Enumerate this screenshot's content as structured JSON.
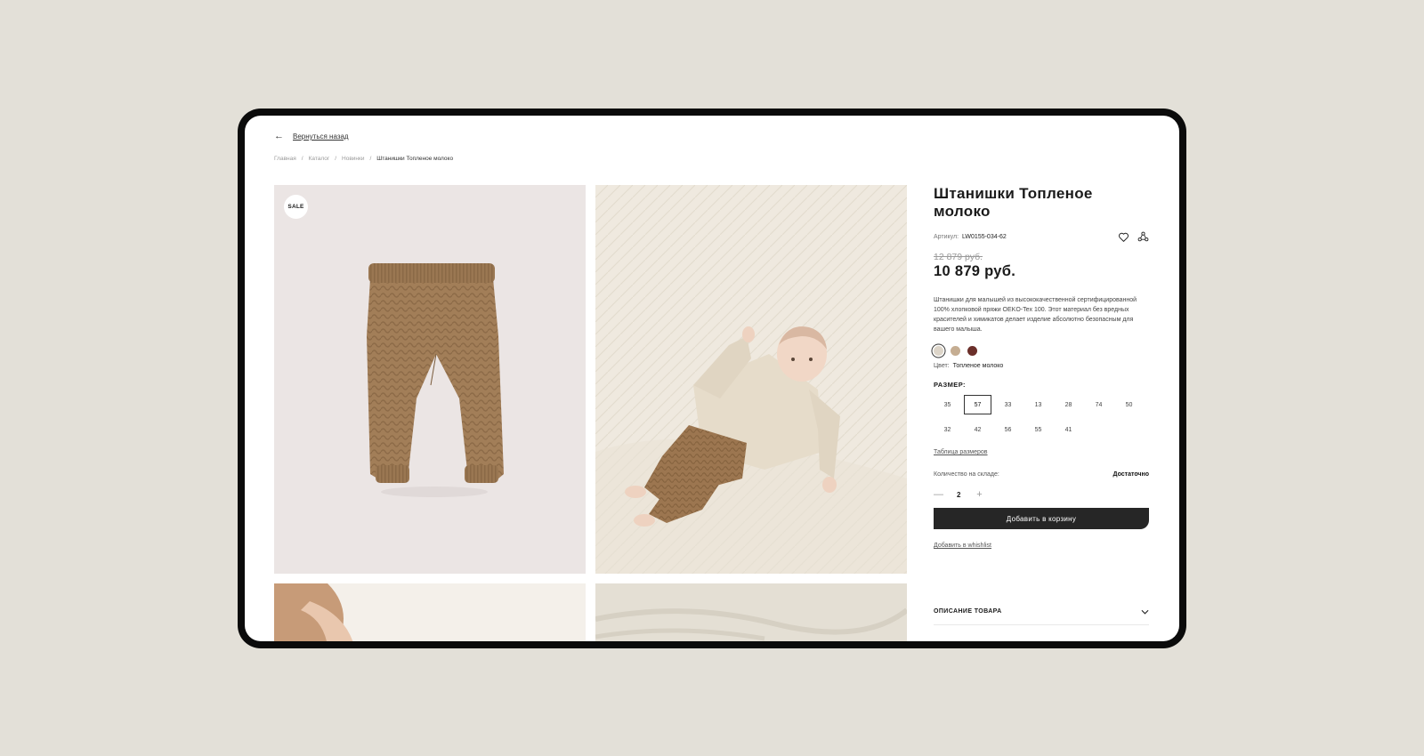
{
  "nav": {
    "back_label": "Вернуться назад"
  },
  "breadcrumb": [
    "Главная",
    "Каталог",
    "Новинки",
    "Штанишки Топленое молоко"
  ],
  "breadcrumb_separator": "/",
  "gallery": {
    "badge": "SALE"
  },
  "product": {
    "title": "Штанишки Топленое молоко",
    "sku_label": "Артикул:",
    "sku": "LW0155-034-62",
    "old_price": "12 879 руб.",
    "price": "10 879 руб.",
    "description": "Штанишки для малышей из высококачественной сертифицированной 100% хлопковой пряжи OEKO-Tex 100. Этот материал без вредных красителей и химикатов делает изделие абсолютно безопасным для вашего малыша.",
    "swatches": [
      "#ddd5c9",
      "#c5ad92",
      "#6b2f2a"
    ],
    "color_label": "Цвет:",
    "color_value": "Топленое молоко",
    "size_heading": "РАЗМЕР:",
    "sizes": [
      "35",
      "57",
      "33",
      "13",
      "28",
      "74",
      "50",
      "32",
      "42",
      "56",
      "55",
      "41"
    ],
    "selected_size": "57",
    "size_table_link": "Таблица размеров",
    "stock_label": "Количество на складе:",
    "stock_value": "Достаточно",
    "quantity": "2",
    "add_to_cart": "Добавить в корзину",
    "add_to_wishlist": "Добавить в whishlist",
    "accordion_title": "ОПИСАНИЕ ТОВАРА"
  },
  "icons": [
    "arrow-left-icon",
    "heart-icon",
    "share-icon",
    "chevron-down-icon",
    "minus-icon",
    "plus-icon"
  ]
}
